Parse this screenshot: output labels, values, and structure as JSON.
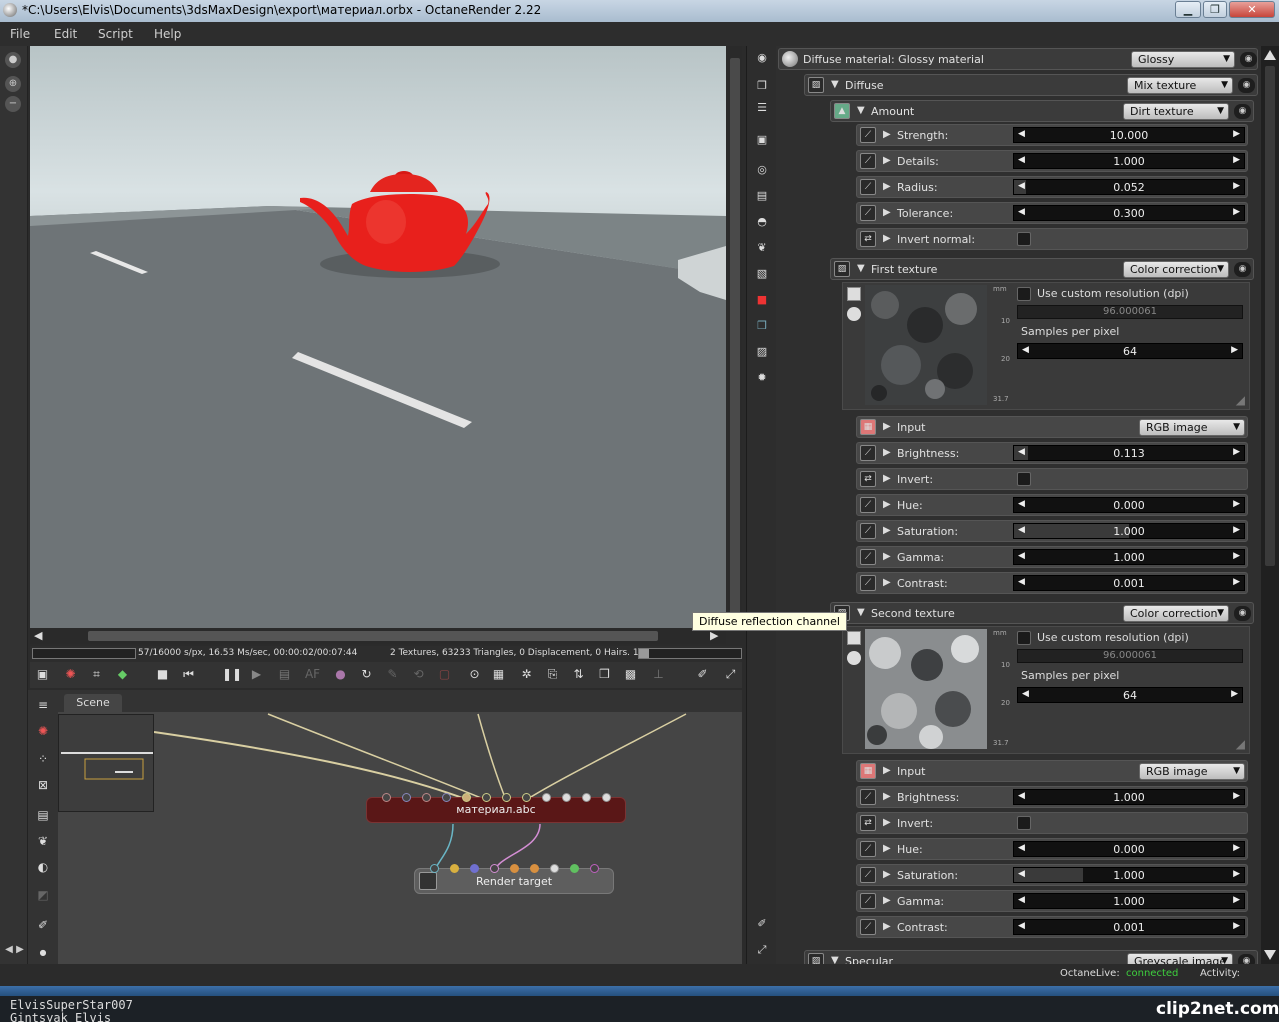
{
  "window": {
    "title": "*C:\\Users\\Elvis\\Documents\\3dsMaxDesign\\export\\материал.orbx - OctaneRender 2.22",
    "buttons": {
      "minimize": "▁",
      "maximize": "❐",
      "close": "✕"
    }
  },
  "menu": [
    "File",
    "Edit",
    "Script",
    "Help"
  ],
  "render_status": {
    "samples": "57/16000 s/px, 16.53 Ms/sec, 00:00:02/00:07:44",
    "scene_info": "2 Textures, 63233 Triangles, 0 Displacement, 0 Hairs. 1 Mes..."
  },
  "tooltip": "Diffuse reflection channel",
  "graph": {
    "tab": "Scene",
    "material_node": "материал.abc",
    "render_node": "Render target"
  },
  "panel": {
    "header": {
      "label": "Diffuse material: Glossy material",
      "type": "Glossy"
    },
    "diffuse": {
      "label": "Diffuse",
      "type": "Mix texture"
    },
    "amount": {
      "label": "Amount",
      "type": "Dirt texture"
    },
    "amount_params": [
      {
        "label": "Strength:",
        "value": "10.000",
        "fill": 0.0
      },
      {
        "label": "Details:",
        "value": "1.000",
        "fill": 0.0
      },
      {
        "label": "Radius:",
        "value": "0.052",
        "fill": 0.05
      },
      {
        "label": "Tolerance:",
        "value": "0.300",
        "fill": 0.0
      }
    ],
    "invert_normal": "Invert normal:",
    "first_texture": {
      "label": "First texture",
      "type": "Color correction",
      "use_custom": "Use custom resolution (dpi)",
      "dpi": "96.000061",
      "samples_label": "Samples per pixel",
      "samples": "64",
      "ruler": [
        "mm",
        "10",
        "20",
        "31.7"
      ],
      "input_label": "Input",
      "input_type": "RGB image",
      "params": [
        {
          "label": "Brightness:",
          "value": "0.113",
          "fill": 0.06
        },
        {
          "label": "Hue:",
          "value": "0.000",
          "fill": 0.0
        },
        {
          "label": "Saturation:",
          "value": "1.000",
          "fill": 0.5
        },
        {
          "label": "Gamma:",
          "value": "1.000",
          "fill": 0.0
        },
        {
          "label": "Contrast:",
          "value": "0.001",
          "fill": 0.0
        }
      ],
      "invert": "Invert:"
    },
    "second_texture": {
      "label": "Second texture",
      "type": "Color correction",
      "use_custom": "Use custom resolution (dpi)",
      "dpi": "96.000061",
      "samples_label": "Samples per pixel",
      "samples": "64",
      "ruler": [
        "mm",
        "10",
        "20",
        "31.7"
      ],
      "input_label": "Input",
      "input_type": "RGB image",
      "params": [
        {
          "label": "Brightness:",
          "value": "1.000",
          "fill": 0.0
        },
        {
          "label": "Hue:",
          "value": "0.000",
          "fill": 0.0
        },
        {
          "label": "Saturation:",
          "value": "1.000",
          "fill": 0.3
        },
        {
          "label": "Gamma:",
          "value": "1.000",
          "fill": 0.0
        },
        {
          "label": "Contrast:",
          "value": "0.001",
          "fill": 0.0
        }
      ],
      "invert": "Invert:"
    },
    "specular": {
      "label": "Specular",
      "type": "Greyscale image"
    }
  },
  "footer": {
    "live_label": "OctaneLive:",
    "live_status": "connected",
    "activity_label": "Activity:"
  },
  "user_caption": [
    "ElvisSuperStar007",
    "Gintsyak Elvis"
  ],
  "watermark": "clip2net.com",
  "colors": {
    "live_status": "#3ecf3e",
    "teapot": "#e8201c",
    "material_node": "#5a1717"
  }
}
